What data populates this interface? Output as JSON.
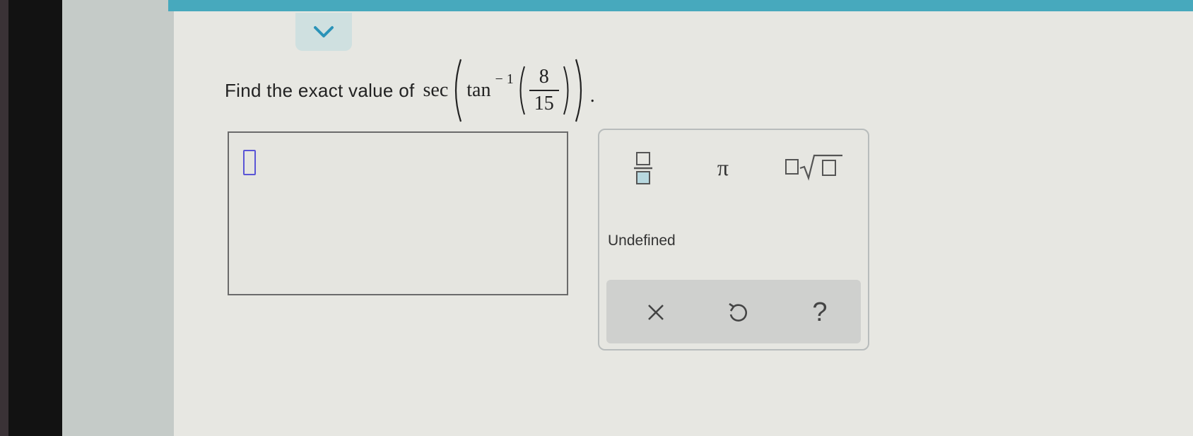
{
  "question": {
    "prompt": "Find the exact value of",
    "outer_function": "sec",
    "inner_function": "tan",
    "inner_exponent": "− 1",
    "fraction": {
      "numerator": "8",
      "denominator": "15"
    },
    "terminator": "."
  },
  "keypad": {
    "pi_label": "π",
    "undefined_label": "Undefined",
    "help_label": "?"
  },
  "icons": {
    "collapse": "chevron-down-icon",
    "fraction": "fraction-template-icon",
    "sqrt": "nth-root-template-icon",
    "clear": "close-icon",
    "undo": "undo-icon"
  },
  "colors": {
    "accent": "#47a9bd",
    "cursor": "#5a55d6",
    "chevron": "#2a93b8"
  }
}
